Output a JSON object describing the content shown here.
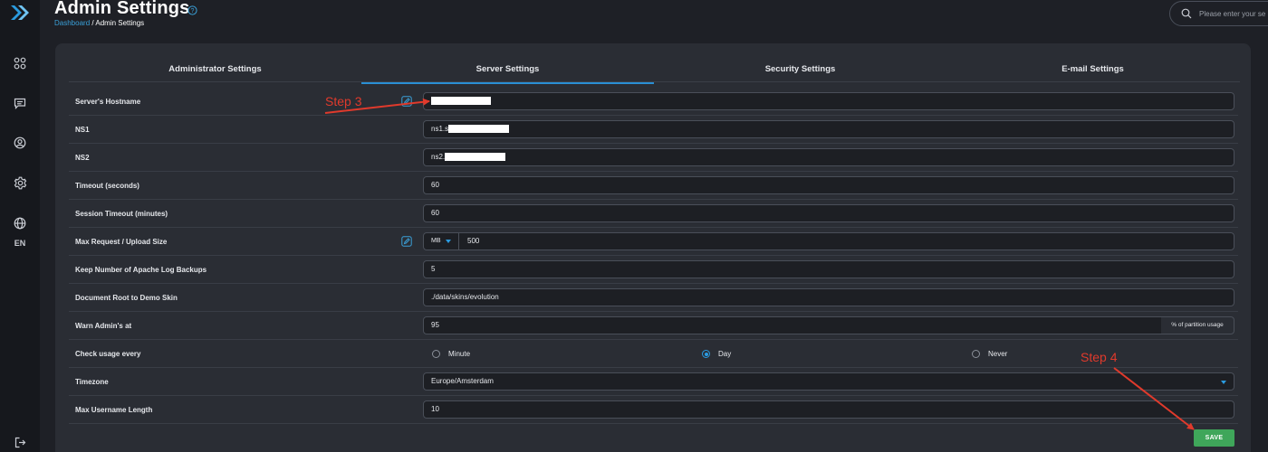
{
  "header": {
    "title": "Admin Settings",
    "breadcrumb": {
      "link": "Dashboard",
      "separator": " / ",
      "current": "Admin Settings"
    },
    "search_placeholder": "Please enter your se"
  },
  "sidebar": {
    "items": [
      {
        "icon": "apps-grid-icon"
      },
      {
        "icon": "message-icon"
      },
      {
        "icon": "user-circle-icon"
      },
      {
        "icon": "gear-icon"
      },
      {
        "icon": "globe-icon",
        "label": "EN"
      }
    ],
    "logout_icon": "logout-icon"
  },
  "tabs": [
    {
      "label": "Administrator Settings",
      "active": false
    },
    {
      "label": "Server Settings",
      "active": true
    },
    {
      "label": "Security Settings",
      "active": false
    },
    {
      "label": "E-mail Settings",
      "active": false
    }
  ],
  "settings": {
    "hostname": {
      "label": "Server's Hostname",
      "value": ""
    },
    "ns1": {
      "label": "NS1",
      "value": "ns1.s"
    },
    "ns2": {
      "label": "NS2",
      "value": "ns2."
    },
    "timeout": {
      "label": "Timeout (seconds)",
      "value": "60"
    },
    "session_timeout": {
      "label": "Session Timeout (minutes)",
      "value": "60"
    },
    "max_upload": {
      "label": "Max Request / Upload Size",
      "unit": "MB",
      "value": "500"
    },
    "apache_backups": {
      "label": "Keep Number of Apache Log Backups",
      "value": "5"
    },
    "demo_skin": {
      "label": "Document Root to Demo Skin",
      "value": "./data/skins/evolution"
    },
    "warn_admin": {
      "label": "Warn Admin's at",
      "value": "95",
      "suffix": "% of partition usage"
    },
    "check_usage": {
      "label": "Check usage every",
      "options": [
        "Minute",
        "Day",
        "Never"
      ],
      "selected": "Day"
    },
    "timezone": {
      "label": "Timezone",
      "value": "Europe/Amsterdam"
    },
    "max_username": {
      "label": "Max Username Length",
      "value": "10"
    }
  },
  "save_label": "SAVE",
  "annotations": {
    "step3": "Step 3",
    "step4": "Step 4",
    "color": "#e03a2c"
  },
  "colors": {
    "accent": "#2a8fd4",
    "save": "#3fa65a",
    "background": "#1e2026",
    "card": "#2a2d34"
  }
}
